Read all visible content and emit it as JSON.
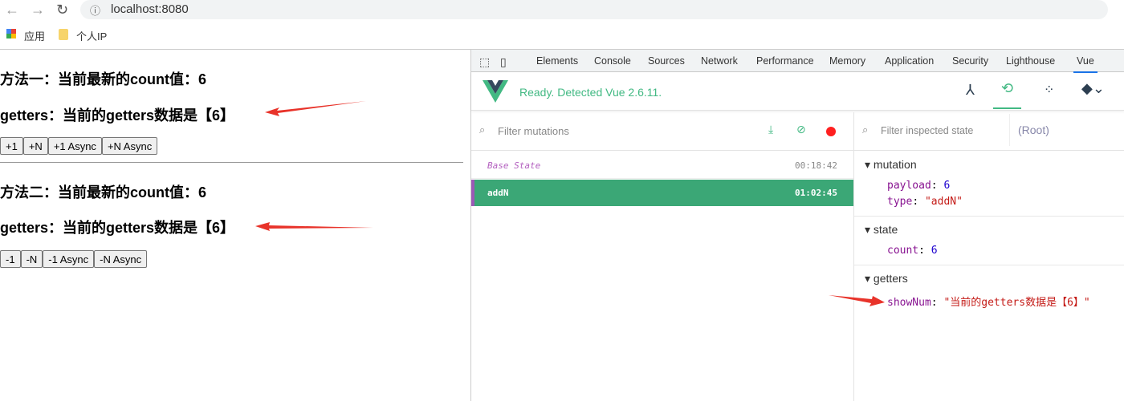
{
  "browser": {
    "url": "localhost:8080",
    "bookmarks": [
      {
        "label": "应用",
        "icon": "apps-grid-icon"
      },
      {
        "label": "个人IP",
        "icon": "folder-icon"
      }
    ]
  },
  "page": {
    "section1": {
      "count_text": "方法一：当前最新的count值：6",
      "getters_text": "getters：当前的getters数据是【6】",
      "buttons": [
        "+1",
        "+N",
        "+1 Async",
        "+N Async"
      ]
    },
    "section2": {
      "count_text": "方法二：当前最新的count值：6",
      "getters_text": "getters：当前的getters数据是【6】",
      "buttons": [
        "-1",
        "-N",
        "-1 Async",
        "-N Async"
      ]
    }
  },
  "devtools": {
    "tabs": [
      "Elements",
      "Console",
      "Sources",
      "Network",
      "Performance",
      "Memory",
      "Application",
      "Security",
      "Lighthouse",
      "Vue"
    ],
    "active_tab": "Vue",
    "status": "Ready. Detected Vue 2.6.11.",
    "filter_mutations_placeholder": "Filter mutations",
    "filter_state_placeholder": "Filter inspected state",
    "root_label": "(Root)",
    "mutations": [
      {
        "name": "Base State",
        "time": "00:18:42"
      },
      {
        "name": "addN",
        "time": "01:02:45",
        "selected": true
      }
    ],
    "inspector": {
      "mutation": {
        "title": "mutation",
        "payload_key": "payload",
        "payload": "6",
        "type_key": "type",
        "type": "\"addN\""
      },
      "state": {
        "title": "state",
        "count_key": "count",
        "count": "6"
      },
      "getters": {
        "title": "getters",
        "key": "showNum",
        "value": "\"当前的getters数据是【6】\""
      }
    },
    "colors": {
      "vue_green": "#42b983",
      "selected_row": "#3ba776",
      "selected_bar": "#9b59b6",
      "record": "#ff2020"
    }
  }
}
